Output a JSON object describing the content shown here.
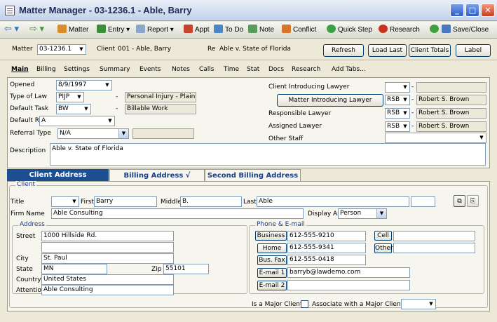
{
  "window": {
    "title": "Matter Manager - 03-1236.1 - Able, Barry"
  },
  "toolbar": {
    "matter": "Matter",
    "entry": "Entry",
    "report": "Report",
    "appt": "Appt",
    "todo": "To Do",
    "note": "Note",
    "conflict": "Conflict",
    "quickstep": "Quick Step",
    "research": "Research",
    "saveclose": "Save/Close"
  },
  "header": {
    "matter_label": "Matter",
    "matter_value": "03-1236.1",
    "client_label": "Client",
    "client_value": "001 - Able, Barry",
    "re_label": "Re",
    "re_value": "Able v. State of Florida",
    "refresh": "Refresh",
    "load_last": "Load Last",
    "client_totals": "Client Totals",
    "label": "Label"
  },
  "tabs": [
    "Main",
    "Billing",
    "Settings",
    "Summary",
    "Events",
    "Notes",
    "Calls",
    "Time",
    "Stat",
    "Docs",
    "Research",
    "Add Tabs..."
  ],
  "main": {
    "opened_label": "Opened",
    "opened_value": "8/9/1997",
    "type_of_law_label": "Type of Law",
    "type_of_law_value": "PIJP",
    "type_of_law_desc": "Personal Injury - Plainti",
    "default_task_label": "Default Task",
    "default_task_value": "BW",
    "default_task_desc": "Billable Work",
    "default_rate_label": "Default Rate",
    "default_rate_value": "A",
    "referral_type_label": "Referral Type",
    "referral_type_value": "N/A",
    "description_label": "Description",
    "description_value": "Able v. State of Florida",
    "client_intro_lawyer_label": "Client Introducing Lawyer",
    "matter_intro_lawyer_button": "Matter Introducing Lawyer",
    "matter_intro_code": "RSB",
    "matter_intro_name": "Robert S. Brown",
    "responsible_lawyer_label": "Responsible Lawyer",
    "responsible_code": "RSB",
    "responsible_name": "Robert S. Brown",
    "assigned_lawyer_label": "Assigned Lawyer",
    "assigned_code": "RSB",
    "assigned_name": "Robert S. Brown",
    "other_staff_label": "Other Staff"
  },
  "address_tabs": {
    "client": "Client Address",
    "billing": "Billing Address  √",
    "second": "Second Billing Address"
  },
  "client": {
    "group_label": "Client",
    "title_label": "Title",
    "first_label": "First",
    "first_value": "Barry",
    "middle_label": "Middle",
    "middle_value": "B.",
    "last_label": "Last",
    "last_value": "Able",
    "firm_name_label": "Firm Name",
    "firm_name_value": "Able Consulting",
    "display_as_label": "Display As",
    "display_as_value": "Person"
  },
  "address": {
    "group_label": "Address",
    "street_label": "Street",
    "street_value": "1000 Hillside Rd.",
    "city_label": "City",
    "city_value": "St. Paul",
    "state_label": "State",
    "state_value": "MN",
    "zip_label": "Zip",
    "zip_value": "55101",
    "country_label": "Country",
    "country_value": "United States",
    "attention_label": "Attention",
    "attention_value": "Able Consulting"
  },
  "phone": {
    "group_label": "Phone & E-mail",
    "business_button": "Business",
    "business_value": "612-555-9210",
    "home_button": "Home",
    "home_value": "612-555-9341",
    "busfax_button": "Bus. Fax",
    "busfax_value": "612-555-0418",
    "email1_button": "E-mail 1",
    "email1_value": "barryb@lawdemo.com",
    "email2_button": "E-mail 2",
    "cell_button": "Cell",
    "other_button": "Other"
  },
  "footer": {
    "major_client_label": "Is a Major Client",
    "associate_label": "Associate with a Major Client"
  }
}
